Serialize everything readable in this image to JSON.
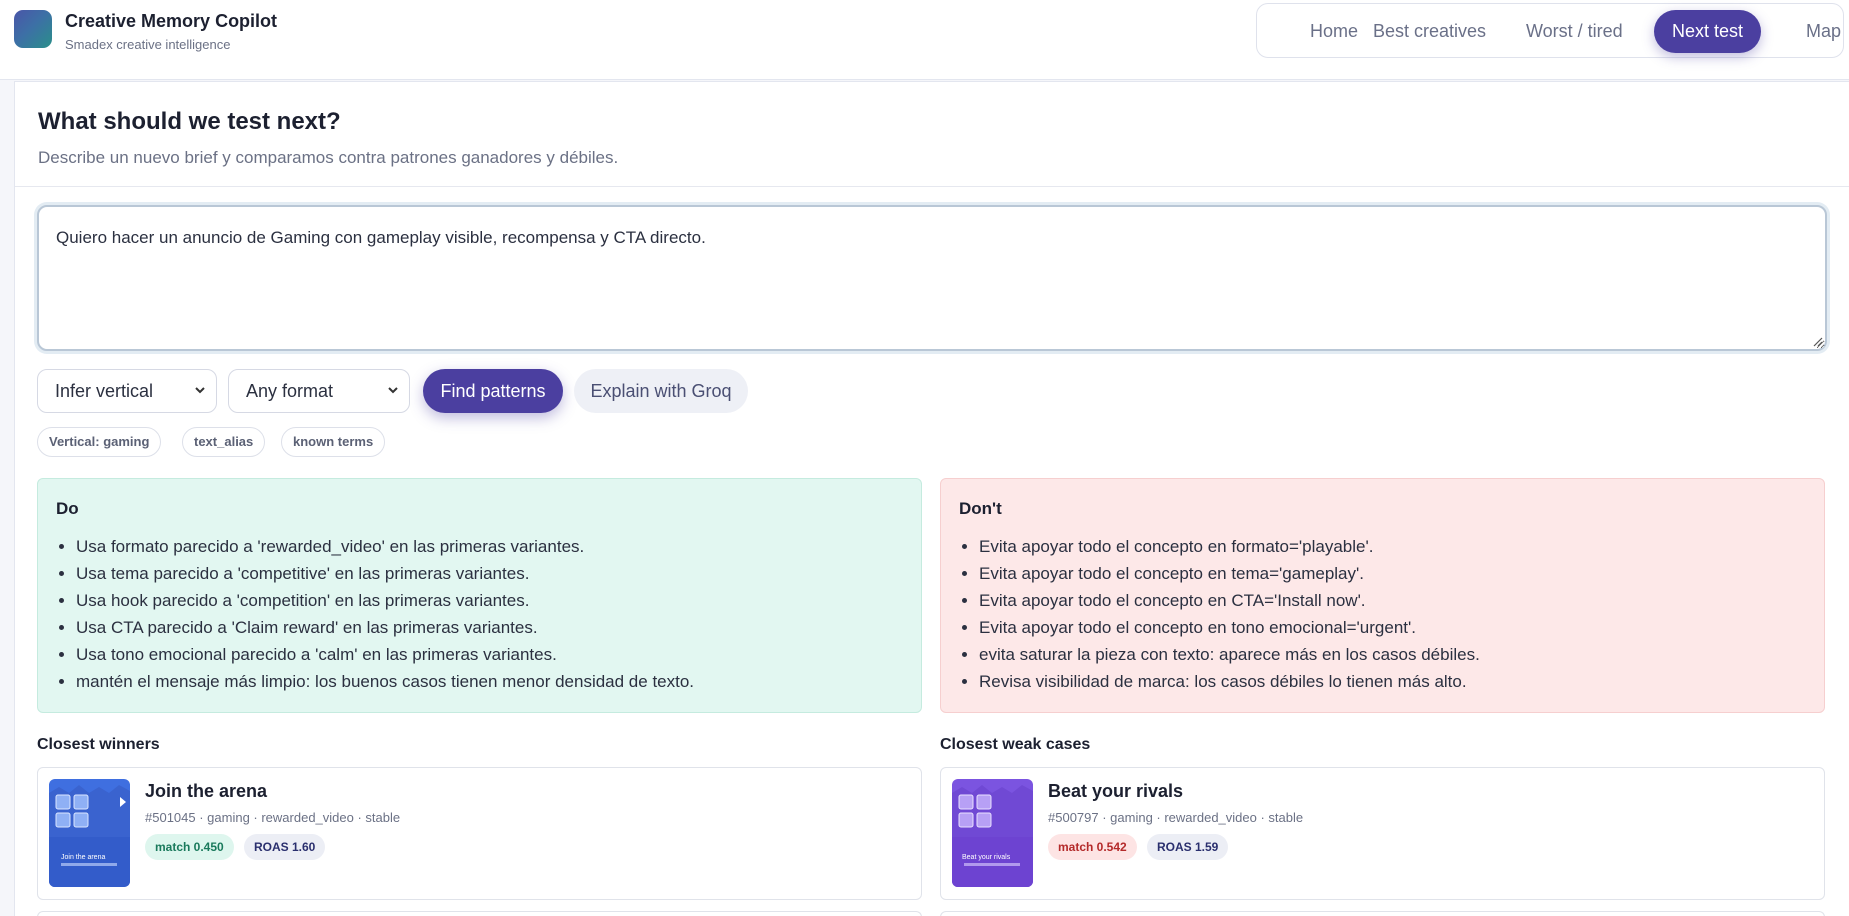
{
  "app": {
    "title": "Creative Memory Copilot",
    "subtitle": "Smadex creative intelligence",
    "brand_gradient": [
      "#4a55a8",
      "#2a8f8a"
    ]
  },
  "nav": {
    "items": [
      "Home",
      "Best creatives",
      "Worst / tired",
      "Next test",
      "Map"
    ],
    "active": "Next test",
    "accent": "#4b3fa0"
  },
  "page": {
    "title": "What should we test next?",
    "subtitle": "Describe un nuevo brief y comparamos contra patrones ganadores y débiles."
  },
  "brief": {
    "value": "Quiero hacer un anuncio de Gaming con gameplay visible, recompensa y CTA directo."
  },
  "controls": {
    "vertical_select": "Infer vertical",
    "format_select": "Any format",
    "find_button": "Find patterns",
    "explain_button": "Explain with Groq"
  },
  "chips": [
    "Vertical: gaming",
    "text_alias",
    "known terms"
  ],
  "do": {
    "title": "Do",
    "items": [
      "Usa formato parecido a 'rewarded_video' en las primeras variantes.",
      "Usa tema parecido a 'competitive' en las primeras variantes.",
      "Usa hook parecido a 'competition' en las primeras variantes.",
      "Usa CTA parecido a 'Claim reward' en las primeras variantes.",
      "Usa tono emocional parecido a 'calm' en las primeras variantes.",
      "mantén el mensaje más limpio: los buenos casos tienen menor densidad de texto."
    ]
  },
  "dont": {
    "title": "Don't",
    "items": [
      "Evita apoyar todo el concepto en formato='playable'.",
      "Evita apoyar todo el concepto en tema='gameplay'.",
      "Evita apoyar todo el concepto en CTA='Install now'.",
      "Evita apoyar todo el concepto en tono emocional='urgent'.",
      "evita saturar la pieza con texto: aparece más en los casos débiles.",
      "Revisa visibilidad de marca: los casos débiles lo tienen más alto."
    ]
  },
  "winners": {
    "title": "Closest winners",
    "items": [
      {
        "title": "Join the arena",
        "meta": "#501045 · gaming · rewarded_video · stable",
        "match": "match 0.450",
        "roas": "ROAS 1.60",
        "thumb_text": "Join the arena",
        "thumb_color": "#3f6fe0"
      }
    ]
  },
  "weak": {
    "title": "Closest weak cases",
    "items": [
      {
        "title": "Beat your rivals",
        "meta": "#500797 · gaming · rewarded_video · stable",
        "match": "match 0.542",
        "roas": "ROAS 1.59",
        "thumb_text": "Beat your rivals",
        "thumb_color": "#7b54e0"
      }
    ]
  }
}
